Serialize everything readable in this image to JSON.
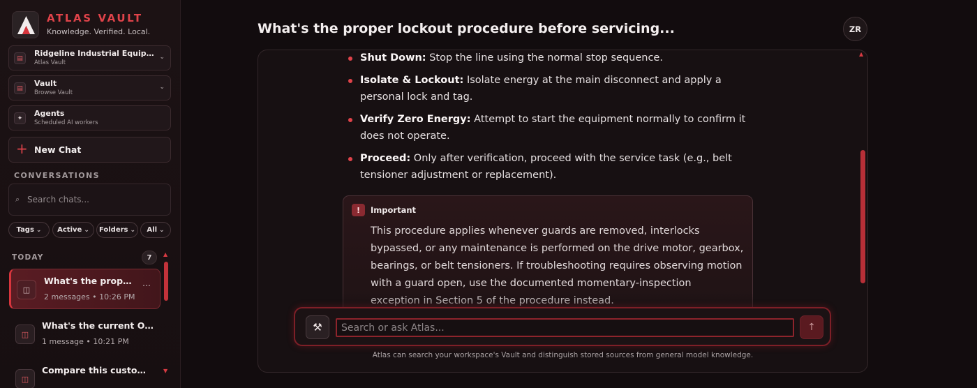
{
  "brand": {
    "name": "ATLAS VAULT",
    "tagline": "Knowledge. Verified. Local."
  },
  "workspace_cards": [
    {
      "title": "Ridgeline Industrial Equipme...",
      "subtitle": "Atlas Vault",
      "icon": "building-icon"
    },
    {
      "title": "Vault",
      "subtitle": "Browse Vault",
      "icon": "vault-icon"
    },
    {
      "title": "Agents",
      "subtitle": "Scheduled AI workers",
      "icon": "sparkle-icon"
    }
  ],
  "new_chat_label": "New Chat",
  "conversations": {
    "heading": "CONVERSATIONS",
    "search_placeholder": "Search chats...",
    "filters": [
      "Tags",
      "Active",
      "Folders",
      "All"
    ],
    "group_label": "TODAY",
    "count": "7",
    "items": [
      {
        "title": "What's the proper lockout procedure before servicing...",
        "meta": "2 messages • 10:26 PM",
        "active": true
      },
      {
        "title": "What's the current OSHA requirement...",
        "meta": "1 message • 10:21 PM",
        "active": false
      },
      {
        "title": "Compare this customer...",
        "meta": "",
        "active": false
      }
    ]
  },
  "main": {
    "title": "What's the proper lockout procedure before servicing...",
    "avatar_initials": "ZR",
    "steps": [
      {
        "label": "Shut Down:",
        "text": "Stop the line using the normal stop sequence."
      },
      {
        "label": "Isolate & Lockout:",
        "text": "Isolate energy at the main disconnect and apply a personal lock and tag."
      },
      {
        "label": "Verify Zero Energy:",
        "text": "Attempt to start the equipment normally to confirm it does not operate."
      },
      {
        "label": "Proceed:",
        "text": "Only after verification, proceed with the service task (e.g., belt tensioner adjustment or replacement)."
      }
    ],
    "callout": {
      "icon": "!",
      "label": "Important",
      "body": "This procedure applies whenever guards are removed, interlocks bypassed, or any maintenance is performed on the drive motor, gearbox, bearings, or belt tensioners. If troubleshooting requires observing motion with a guard open, use the documented momentary-inspection exception in Section 5 of the procedure instead."
    },
    "composer": {
      "placeholder": "Search or ask Atlas...",
      "tool_icon": "⚒",
      "send_icon": "↑"
    },
    "disclaimer": "Atlas can search your workspace's Vault and distinguish stored sources from general model knowledge."
  },
  "colors": {
    "accent": "#e0434a",
    "background": "#120c0e",
    "active_item": "#5a1c23"
  }
}
